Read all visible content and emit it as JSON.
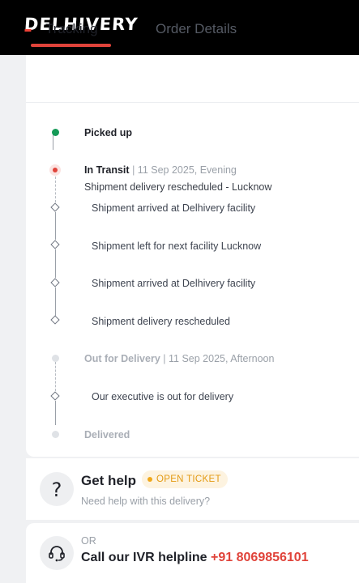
{
  "brand": {
    "logo_text": "DELHIVERY",
    "accent": "#e0433a"
  },
  "tabs": [
    {
      "label": "Tracking",
      "active": true
    },
    {
      "label": "Order Details",
      "active": false
    }
  ],
  "timeline": {
    "picked_up": {
      "label": "Picked up"
    },
    "in_transit": {
      "label": "In Transit",
      "separator": "|",
      "date": "11 Sep 2025, Evening",
      "detail": "Shipment delivery rescheduled - Lucknow",
      "events": [
        "Shipment arrived at Delhivery facility",
        "Shipment left for next facility Lucknow",
        "Shipment arrived at Delhivery facility",
        "Shipment delivery rescheduled"
      ]
    },
    "out_for_delivery": {
      "label": "Out for Delivery",
      "separator": "|",
      "date": "11 Sep 2025, Afternoon",
      "events": [
        "Our executive is out for delivery"
      ]
    },
    "delivered": {
      "label": "Delivered"
    }
  },
  "help": {
    "title": "Get help",
    "badge": "OPEN TICKET",
    "subtitle": "Need help with this delivery?"
  },
  "ivr": {
    "or_label": "OR",
    "text": "Call our IVR helpline",
    "number": "+91 8069856101"
  }
}
